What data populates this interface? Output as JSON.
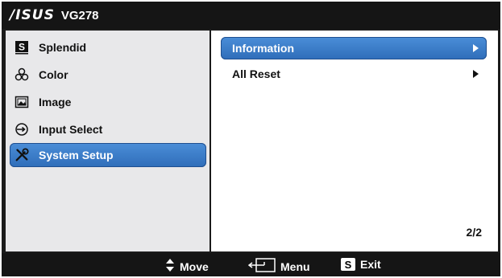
{
  "header": {
    "brand": "/ISUS",
    "model": "VG278"
  },
  "left_menu": {
    "items": [
      {
        "label": "Splendid",
        "icon": "splendid-s-icon",
        "selected": false
      },
      {
        "label": "Color",
        "icon": "color-icon",
        "selected": false
      },
      {
        "label": "Image",
        "icon": "image-icon",
        "selected": false
      },
      {
        "label": "Input Select",
        "icon": "input-select-icon",
        "selected": false
      },
      {
        "label": "System Setup",
        "icon": "wrench-screwdriver-icon",
        "selected": true
      }
    ]
  },
  "submenu": {
    "items": [
      {
        "label": "Information",
        "selected": true
      },
      {
        "label": "All Reset",
        "selected": false
      }
    ],
    "page": "2/2"
  },
  "footer": {
    "move_label": "Move",
    "menu_label": "Menu",
    "exit_label": "Exit",
    "exit_key": "S"
  },
  "colors": {
    "selection_blue": "#3c7ccb",
    "pane_gray": "#e8e8ea",
    "bar_black": "#151515"
  }
}
